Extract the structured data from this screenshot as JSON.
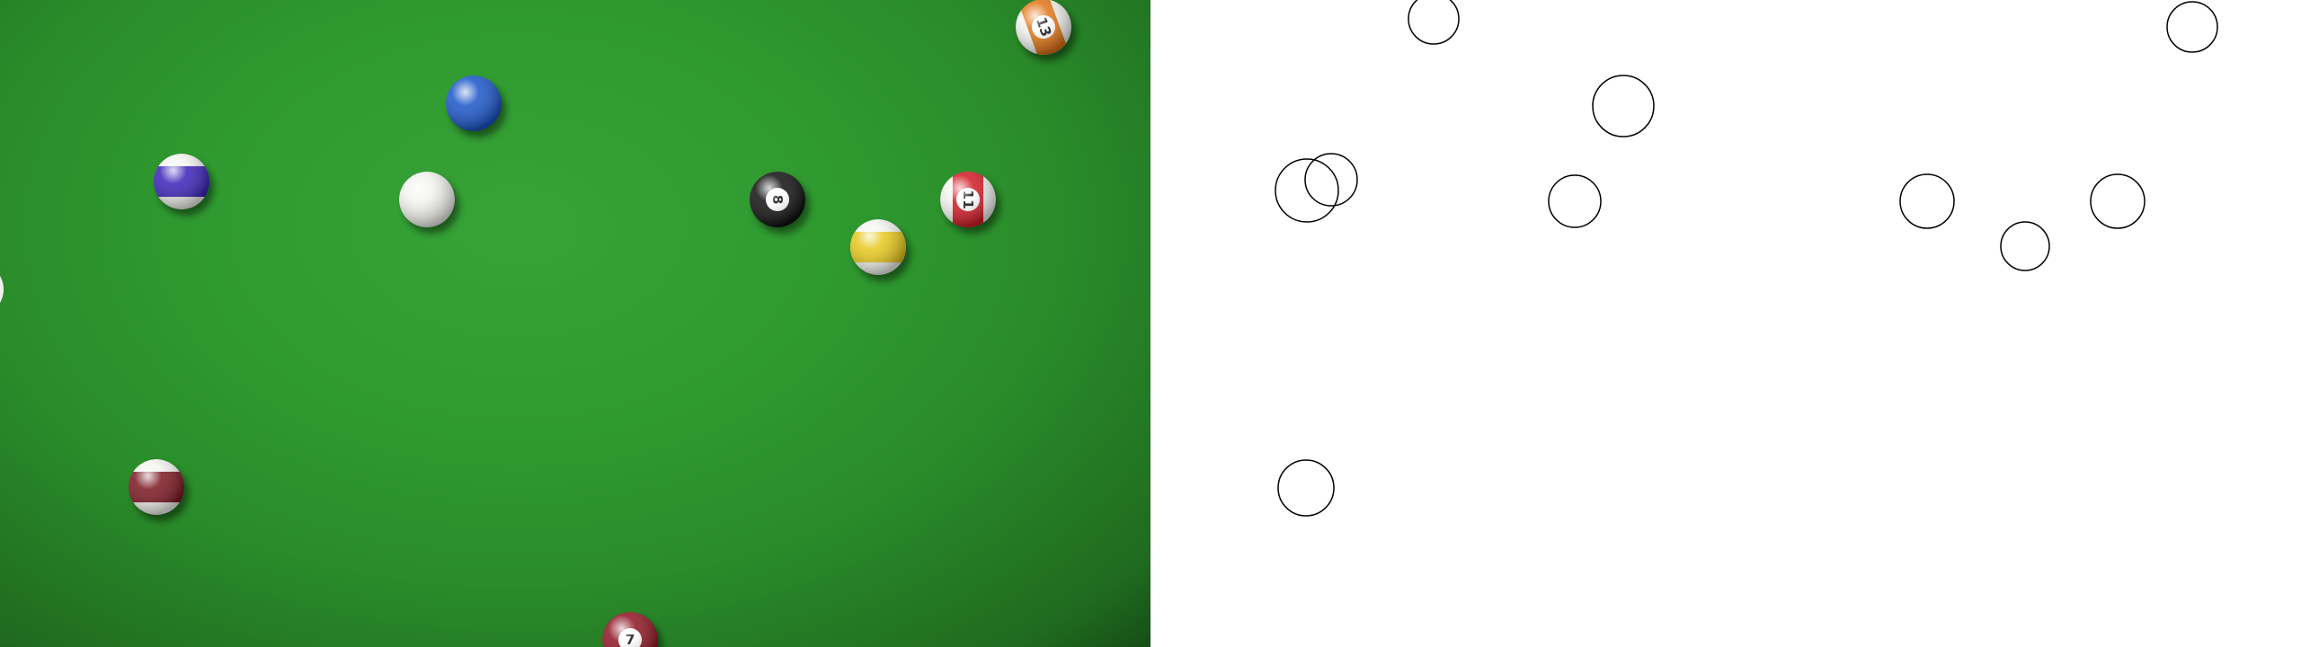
{
  "scene": {
    "felt_color": "#2f9a2f",
    "outline_stroke": "#000000",
    "outline_fill": "#ffffff"
  },
  "balls": [
    {
      "id": "cue",
      "color": "#f2f2ee",
      "stripe": false,
      "label": "",
      "angle": 0
    },
    {
      "id": "yellow-stripe",
      "color": "#e7c81c",
      "stripe": true,
      "label": "",
      "angle": 0
    },
    {
      "id": "eight",
      "color": "#101010",
      "stripe": false,
      "label": "8",
      "angle": 90
    },
    {
      "id": "eleven",
      "color": "#d31a24",
      "stripe": true,
      "label": "11",
      "angle": 90
    },
    {
      "id": "blue",
      "color": "#1a55c9",
      "stripe": false,
      "label": "",
      "angle": 0
    },
    {
      "id": "purple-stripe",
      "color": "#3a22b8",
      "stripe": true,
      "label": "",
      "angle": 0
    },
    {
      "id": "thirteen",
      "color": "#e07416",
      "stripe": true,
      "label": "13",
      "angle": 70
    },
    {
      "id": "maroon-stripe",
      "color": "#7a1620",
      "stripe": true,
      "label": "",
      "angle": 0
    },
    {
      "id": "seven",
      "color": "#8e1422",
      "stripe": false,
      "label": "7",
      "angle": 0
    }
  ],
  "outlines_count": 12
}
